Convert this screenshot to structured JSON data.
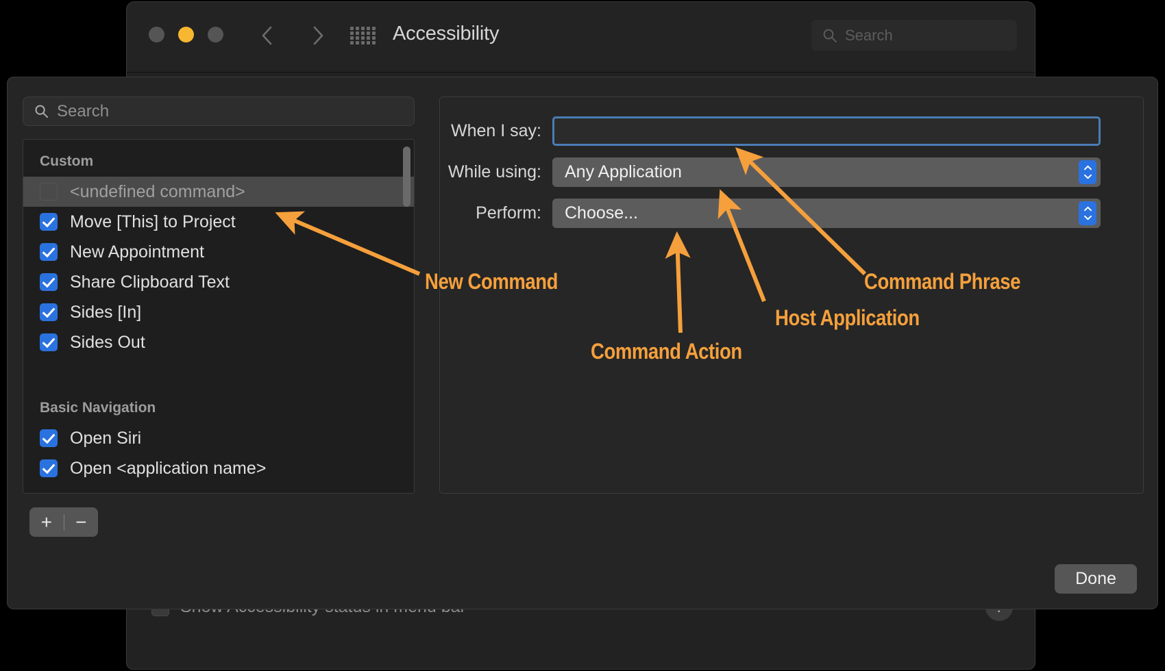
{
  "window": {
    "title": "Accessibility",
    "traffic_lights": [
      "close",
      "minimize",
      "zoom"
    ],
    "nav": {
      "back": "back-chevron",
      "forward": "forward-chevron",
      "grid": "show-all-grid"
    },
    "search": {
      "placeholder": "Search",
      "value": "",
      "icon": "search-icon"
    }
  },
  "background": {
    "menu_bar_checkbox_label": "Show Accessibility status in menu bar",
    "menu_bar_checked": false,
    "help_label": "?"
  },
  "sheet": {
    "list_search": {
      "placeholder": "Search",
      "value": "",
      "icon": "search-icon"
    },
    "groups": [
      {
        "name": "Custom",
        "items": [
          {
            "label": "<undefined command>",
            "checked": false,
            "selected": true
          },
          {
            "label": "Move [This] to Project",
            "checked": true,
            "selected": false
          },
          {
            "label": "New Appointment",
            "checked": true,
            "selected": false
          },
          {
            "label": "Share Clipboard Text",
            "checked": true,
            "selected": false
          },
          {
            "label": "Sides [In]",
            "checked": true,
            "selected": false
          },
          {
            "label": "Sides Out",
            "checked": true,
            "selected": false
          }
        ]
      },
      {
        "name": "Basic Navigation",
        "items": [
          {
            "label": "Open Siri",
            "checked": true,
            "selected": false
          },
          {
            "label": "Open <application name>",
            "checked": true,
            "selected": false
          }
        ]
      }
    ],
    "add_button": "+",
    "remove_button": "−",
    "form": {
      "when_i_say": {
        "label": "When I say:",
        "value": "",
        "focused": true
      },
      "while_using": {
        "label": "While using:",
        "value": "Any Application"
      },
      "perform": {
        "label": "Perform:",
        "value": "Choose..."
      }
    },
    "done_label": "Done"
  },
  "annotations": {
    "accent_color": "#f5a03c",
    "labels": [
      {
        "id": "new-command",
        "text": "New Command"
      },
      {
        "id": "command-action",
        "text": "Command Action"
      },
      {
        "id": "host-application",
        "text": "Host Application"
      },
      {
        "id": "command-phrase",
        "text": "Command Phrase"
      }
    ]
  }
}
